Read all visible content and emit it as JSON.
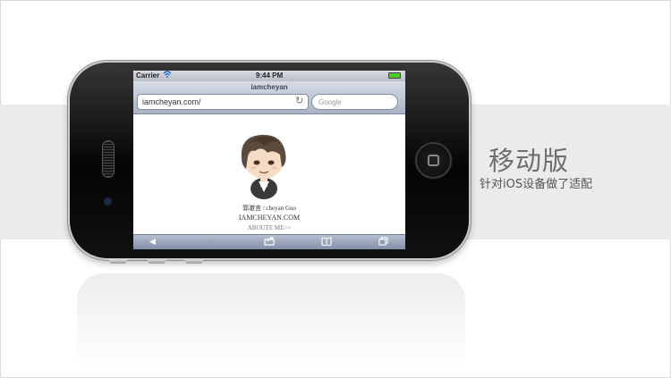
{
  "status_bar": {
    "carrier": "Carrier",
    "time": "9:44 PM"
  },
  "browser": {
    "page_title": "iamcheyan",
    "url": "iamcheyan.com/",
    "search_placeholder": "Google"
  },
  "page": {
    "name_line": "郭澈言 / cheyan Guo",
    "site_line": "IAMCHEYAN.COM",
    "about_link": "ABOUTE ME>>"
  },
  "caption": {
    "title": "移动版",
    "subtitle": "针对iOS设备做了适配"
  },
  "icons": [
    "wifi-icon",
    "battery-icon",
    "reload-icon",
    "back-icon",
    "forward-icon",
    "share-icon",
    "bookmarks-icon",
    "tabs-icon",
    "home-button-icon"
  ],
  "colors": {
    "battery": "#4fc62a",
    "band": "#ebebeb",
    "toolbar": "#8f9cb3"
  }
}
